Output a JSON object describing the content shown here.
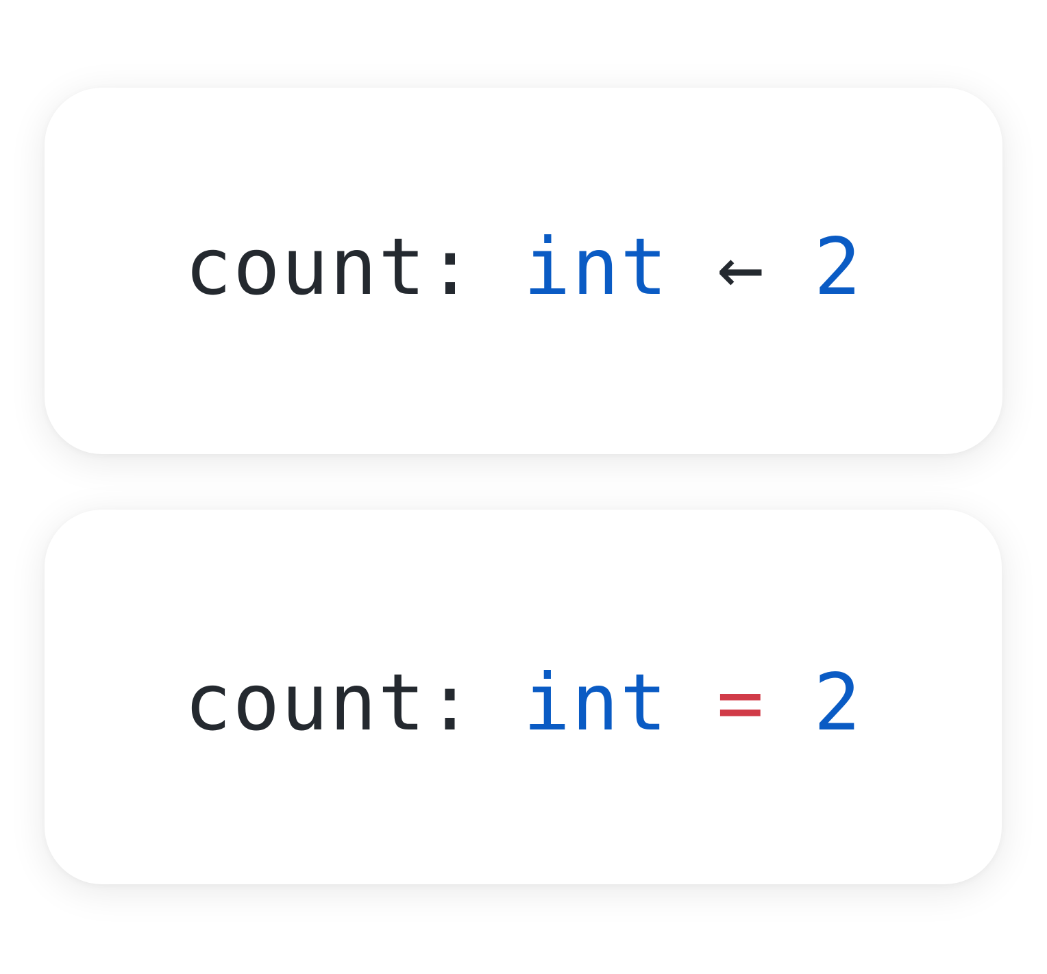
{
  "colors": {
    "text": "#24292f",
    "keyword_type": "#0a5bc4",
    "number": "#0a5bc4",
    "operator_default": "#24292f",
    "operator_highlight": "#d13b48",
    "card_background": "#ffffff"
  },
  "cards": [
    {
      "identifier": "count",
      "colon": ":",
      "type": "int",
      "operator": "←",
      "value": "2"
    },
    {
      "identifier": "count",
      "colon": ":",
      "type": "int",
      "operator": "=",
      "value": "2"
    }
  ]
}
